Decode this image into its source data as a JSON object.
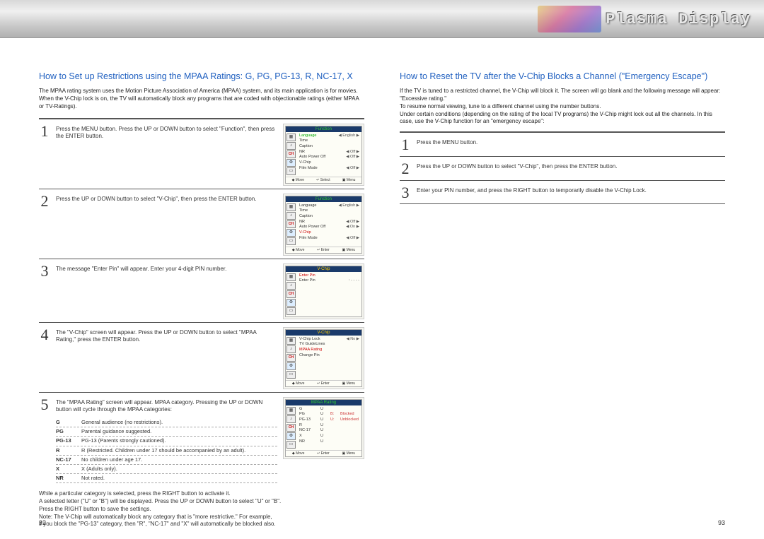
{
  "header": {
    "brand": "Plasma Display"
  },
  "left": {
    "title": "How to Set up Restrictions using the MPAA Ratings: G, PG, PG-13, R, NC-17, X",
    "intro": "The MPAA rating system uses the Motion Picture Association of America (MPAA) system, and its main application is for movies. When the V-Chip lock is on, the TV will automatically block any programs that are coded with objectionable ratings (either MPAA or TV-Ratings).",
    "steps": [
      {
        "n": "1",
        "text": "Press the MENU button. Press the UP or DOWN button to select \"Function\", then press the ENTER button."
      },
      {
        "n": "2",
        "text": "Press the UP or DOWN button to select \"V-Chip\", then press the ENTER button."
      },
      {
        "n": "3",
        "text": "The message \"Enter Pin\" will appear. Enter your 4-digit PIN number."
      },
      {
        "n": "4",
        "text": "The \"V-Chip\" screen will appear. Press the UP or DOWN button to select \"MPAA Rating,\" press the ENTER button."
      },
      {
        "n": "5",
        "text": "The \"MPAA Rating\" screen will appear. MPAA category. Pressing the UP or DOWN button will cycle through the MPAA categories:"
      }
    ],
    "ratings": [
      {
        "k": "G",
        "v": "General audience (no restrictions)."
      },
      {
        "k": "PG",
        "v": "Parental guidance suggested."
      },
      {
        "k": "PG-13",
        "v": "PG-13 (Parents strongly cautioned)."
      },
      {
        "k": "R",
        "v": "R (Restricted. Children under 17 should be accompanied by an adult)."
      },
      {
        "k": "NC-17",
        "v": "No children under age 17."
      },
      {
        "k": "X",
        "v": "X (Adults only)."
      },
      {
        "k": "NR",
        "v": "Not rated."
      }
    ],
    "footer": "While a particular category is selected, press the RIGHT button to activate it.\nA selected letter (\"U\" or \"B\") will be displayed. Press the UP or DOWN button to select \"U\" or \"B\".\nPress the RIGHT button to save the settings.\nNote: The V-Chip will automatically block any category that is \"more restrictive.\" For example,\nif you block the \"PG-13\" category, then \"R\", \"NC-17\" and \"X\" will automatically be blocked also.",
    "pagenum": "92"
  },
  "right": {
    "title": "How to Reset the TV after the V-Chip Blocks a Channel (\"Emergency Escape\")",
    "intro": "If the TV is tuned to a restricted channel, the V-Chip will block it. The screen will go blank and the following message will appear: \"Excessive rating.\"\nTo resume normal viewing, tune to a different channel using the number buttons.\nUnder certain conditions (depending on the rating of the local TV programs) the V-Chip might lock out all the channels. In this case, use the V-Chip function for an \"emergency escape\":",
    "steps": [
      {
        "n": "1",
        "text": "Press the MENU button."
      },
      {
        "n": "2",
        "text": "Press the UP or DOWN button to select \"V-Chip\", then press the ENTER button."
      },
      {
        "n": "3",
        "text": "Enter your PIN number, and press the RIGHT button to temporarily disable the V-Chip Lock."
      }
    ],
    "pagenum": "93"
  },
  "tvmenus": {
    "func1": {
      "title": "Function",
      "rows": [
        {
          "l": "Language",
          "v": "◀ English ▶",
          "hi": true
        },
        {
          "l": "Time",
          "v": ""
        },
        {
          "l": "Caption",
          "v": ""
        },
        {
          "l": "NR",
          "v": "◀ Off ▶"
        },
        {
          "l": "Auto Power Off",
          "v": "◀ Off ▶"
        },
        {
          "l": "V-Chip",
          "v": ""
        },
        {
          "l": "Film Mode",
          "v": "◀ Off ▶"
        }
      ],
      "foot": [
        "◆ Move",
        "↵ Select",
        "▣ Menu"
      ]
    },
    "func2": {
      "title": "Function",
      "rows": [
        {
          "l": "Language",
          "v": "◀ English ▶"
        },
        {
          "l": "Time",
          "v": ""
        },
        {
          "l": "Caption",
          "v": ""
        },
        {
          "l": "NR",
          "v": "◀ Off ▶"
        },
        {
          "l": "Auto Power Off",
          "v": "◀ On ▶"
        },
        {
          "l": "V-Chip",
          "v": "",
          "hired": true
        },
        {
          "l": "Film Mode",
          "v": "◀ Off ▶"
        }
      ],
      "foot": [
        "◆ Move",
        "↵ Enter",
        "▣ Menu"
      ]
    },
    "vchip_pin": {
      "title": "V-Chip",
      "rows": [
        {
          "l": "Enter Pin",
          "v": "",
          "hired": true
        },
        {
          "l": "     Enter Pin",
          "v": ":  - - - -"
        }
      ],
      "foot": []
    },
    "vchip_menu": {
      "title": "V-Chip",
      "rows": [
        {
          "l": "V-Chip Lock",
          "v": "◀ No ▶"
        },
        {
          "l": "TV GuideLines",
          "v": ""
        },
        {
          "l": "MPAA Rating",
          "v": "",
          "hired": true
        },
        {
          "l": "Change Pin",
          "v": ""
        }
      ],
      "foot": [
        "◆ Move",
        "↵ Enter",
        "▣ Menu"
      ]
    },
    "mpaa": {
      "title": "MPAA Rating",
      "rows": [
        {
          "c1": "G",
          "c2": "U",
          "c3": "",
          "c4": ""
        },
        {
          "c1": "PG",
          "c2": "U",
          "c3": "B:",
          "c4": "Blocked"
        },
        {
          "c1": "PG-13",
          "c2": "U",
          "c3": "U:",
          "c4": "Unblocked"
        },
        {
          "c1": "R",
          "c2": "U",
          "c3": "",
          "c4": ""
        },
        {
          "c1": "NC-17",
          "c2": "U",
          "c3": "",
          "c4": ""
        },
        {
          "c1": "X",
          "c2": "U",
          "c3": "",
          "c4": ""
        },
        {
          "c1": "NR",
          "c2": "U",
          "c3": "",
          "c4": ""
        }
      ],
      "foot": [
        "◆ Move",
        "↵ Enter",
        "▣ Menu"
      ]
    }
  }
}
